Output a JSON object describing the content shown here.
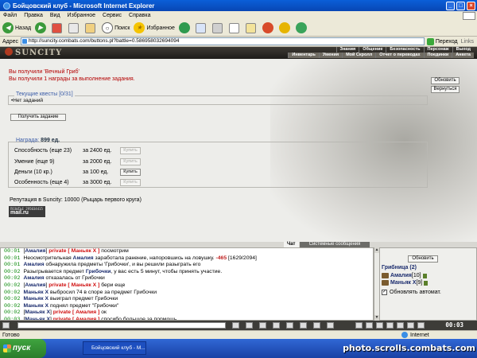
{
  "window": {
    "title": "Бойцовский клуб - Microsoft Internet Explorer"
  },
  "menu": [
    "Файл",
    "Правка",
    "Вид",
    "Избранное",
    "Сервис",
    "Справка"
  ],
  "toolbar": {
    "back": "Назад",
    "search": "Поиск",
    "favorites": "Избранное"
  },
  "address": {
    "label": "Адрес",
    "url": "http://suncity.combats.com/buttons.pl?battle=0.586958032694094",
    "go": "Переход",
    "links": "Links"
  },
  "game": {
    "logo": "SUNCITY",
    "nav_top": [
      "Знания",
      "Общение",
      "Безопасность",
      "Персонаж",
      "Выход"
    ],
    "nav_bottom": [
      "Инвентарь",
      "Умения",
      "Мой Скролл",
      "Отчет о переводах",
      "Поединки",
      "Анкета"
    ]
  },
  "messages": [
    "Вы получили 'Вечный Гриб'",
    "Вы получили 1 награды за выполнение задания."
  ],
  "buttons": {
    "refresh": "Обновить",
    "return": "Вернуться",
    "get_task": "Получить задание"
  },
  "quests": {
    "legend": "Текущие квесты [0/31]",
    "empty": "Нет заданий"
  },
  "reward": {
    "label": "Награда:",
    "value": "899 ед."
  },
  "shop": {
    "buy_label": "Купить",
    "rows": [
      {
        "name": "Способность (еще 23)",
        "price": "за 2400 ед.",
        "enabled": false
      },
      {
        "name": "Умение (еще 9)",
        "price": "за 2000 ед.",
        "enabled": false
      },
      {
        "name": "Деньги (10 кр.)",
        "price": "за 100 ед.",
        "enabled": true
      },
      {
        "name": "Особенность (еще 4)",
        "price": "за 3000 ед.",
        "enabled": false
      }
    ]
  },
  "reputation": "Репутация в Suncity: 10000 (Рыцарь первого круга)",
  "counter": {
    "line1": "ПОЗЫТЬЕ 295034415",
    "line2": "mail.ru"
  },
  "chat": {
    "tab_chat": "Чат",
    "tab_system": "Системные сообщения",
    "lines": [
      {
        "time": "00:01",
        "parts": [
          {
            "t": "[",
            "c": ""
          },
          {
            "t": "Амалия",
            "c": "user"
          },
          {
            "t": "] ",
            "c": ""
          },
          {
            "t": "private [ Маньяк X ]",
            "c": "priv"
          },
          {
            "t": " посмотрим",
            "c": ""
          }
        ]
      },
      {
        "time": "00:01",
        "parts": [
          {
            "t": "Неосмотрительная ",
            "c": ""
          },
          {
            "t": "Амалия",
            "c": "user"
          },
          {
            "t": " заработала ранение, напоровшись на ловушку. ",
            "c": ""
          },
          {
            "t": "-465",
            "c": "red"
          },
          {
            "t": " [1629/2094]",
            "c": ""
          }
        ]
      },
      {
        "time": "00:01",
        "parts": [
          {
            "t": "Амалия",
            "c": "user"
          },
          {
            "t": " обнаружила предметы 'Грибочки', и вы решили разыграть его",
            "c": ""
          }
        ]
      },
      {
        "time": "00:02",
        "parts": [
          {
            "t": "Разыгрывается предмет ",
            "c": ""
          },
          {
            "t": "Грибочки",
            "c": "user"
          },
          {
            "t": ", у вас есть 5 минут, чтобы принять участие.",
            "c": ""
          }
        ]
      },
      {
        "time": "00:02",
        "parts": [
          {
            "t": "Амалия",
            "c": "user"
          },
          {
            "t": " отказалась от Грибочки",
            "c": ""
          }
        ]
      },
      {
        "time": "00:02",
        "parts": [
          {
            "t": "[",
            "c": ""
          },
          {
            "t": "Амалия",
            "c": "user"
          },
          {
            "t": "] ",
            "c": ""
          },
          {
            "t": "private [ Маньяк X ]",
            "c": "priv"
          },
          {
            "t": " бери еще",
            "c": ""
          }
        ]
      },
      {
        "time": "00:02",
        "parts": [
          {
            "t": "Маньяк X",
            "c": "user"
          },
          {
            "t": " выбросил 74 в споре за предмет Грибочки",
            "c": ""
          }
        ]
      },
      {
        "time": "00:02",
        "parts": [
          {
            "t": "Маньяк X",
            "c": "user"
          },
          {
            "t": " выиграл предмет Грибочки",
            "c": ""
          }
        ]
      },
      {
        "time": "00:02",
        "parts": [
          {
            "t": "Маньяк X",
            "c": "user"
          },
          {
            "t": " поднял предмет \"Грибочки\"",
            "c": ""
          }
        ]
      },
      {
        "time": "00:02",
        "parts": [
          {
            "t": "[",
            "c": ""
          },
          {
            "t": "Маньяк X",
            "c": "user"
          },
          {
            "t": "] ",
            "c": ""
          },
          {
            "t": "private [ Амалия ]",
            "c": "priv"
          },
          {
            "t": " ок",
            "c": ""
          }
        ]
      },
      {
        "time": "00:03",
        "parts": [
          {
            "t": "[",
            "c": ""
          },
          {
            "t": "Маньяк X",
            "c": "user"
          },
          {
            "t": "] ",
            "c": ""
          },
          {
            "t": "private [ Амалия ]",
            "c": "priv"
          },
          {
            "t": " спосибо большое за пормощь",
            "c": ""
          }
        ]
      }
    ]
  },
  "online": {
    "refresh": "Обновить",
    "room": "Грибница (2)",
    "people": [
      {
        "name": "Амалия",
        "level": "[10]"
      },
      {
        "name": "Маньяк X",
        "level": "[9]"
      }
    ],
    "auto_label": "Обновлять автомат.",
    "auto_checked": true
  },
  "clock": "00:03",
  "status": {
    "text": "Готово",
    "zone": "Internet"
  },
  "taskbar": {
    "start": "пуск",
    "item": "Бойцовский клуб - M...",
    "watermark": "photo.scrolls.combats.com"
  }
}
